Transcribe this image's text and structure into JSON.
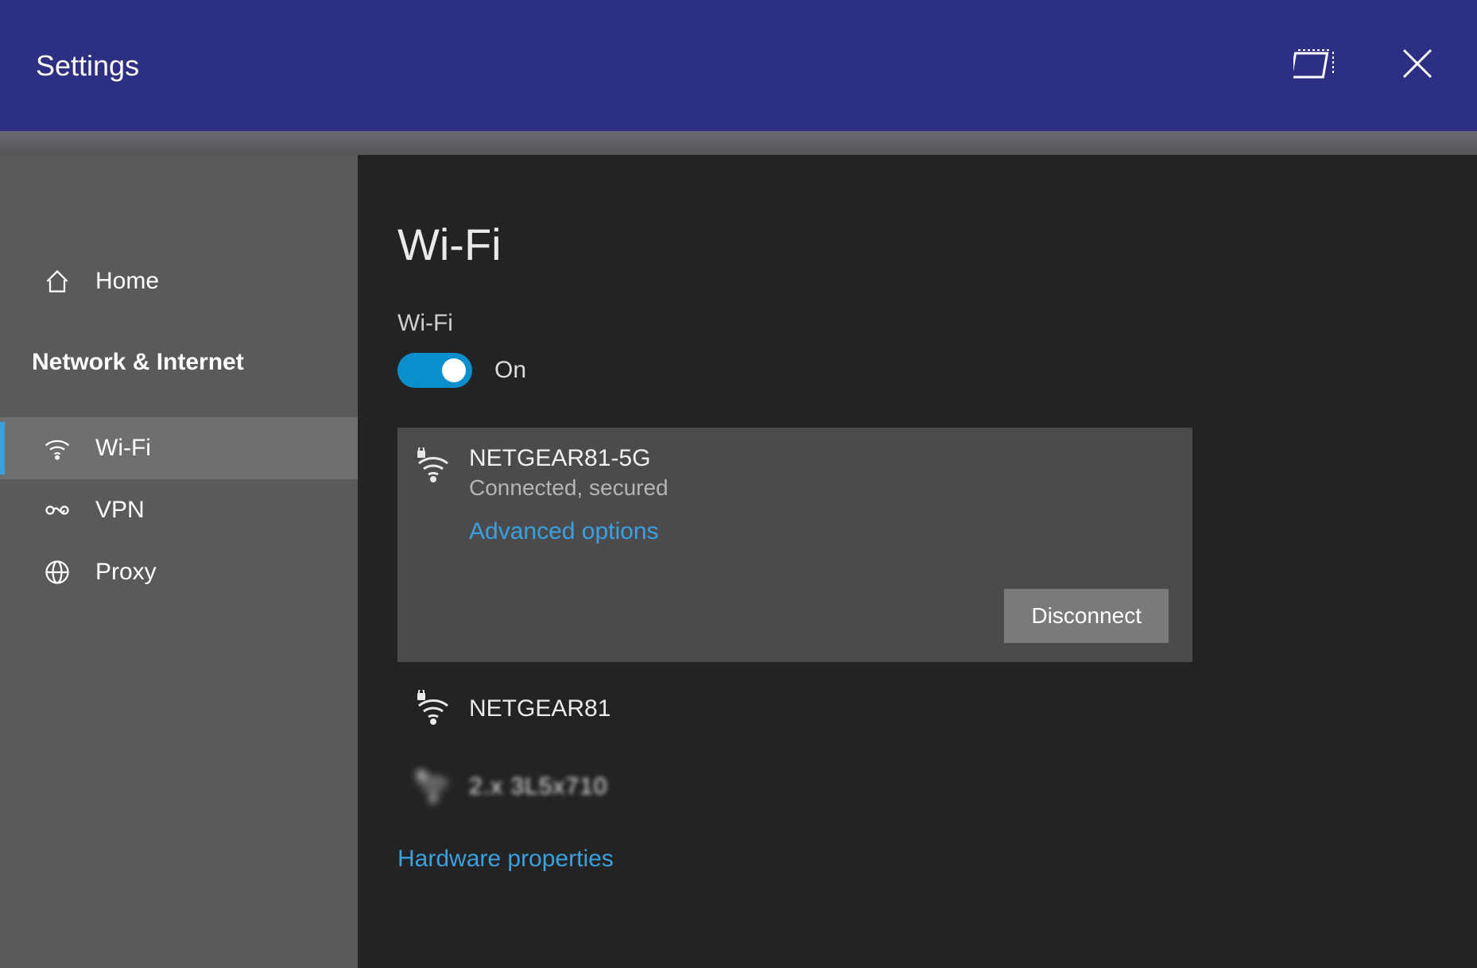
{
  "titlebar": {
    "title": "Settings"
  },
  "sidebar": {
    "home": "Home",
    "section_header": "Network & Internet",
    "items": [
      {
        "label": "Wi-Fi"
      },
      {
        "label": "VPN"
      },
      {
        "label": "Proxy"
      }
    ]
  },
  "main": {
    "page_title": "Wi-Fi",
    "wifi_label": "Wi-Fi",
    "toggle_state": "On",
    "connected_network": {
      "name": "NETGEAR81-5G",
      "status": "Connected, secured",
      "advanced_link": "Advanced options",
      "disconnect_label": "Disconnect"
    },
    "other_networks": [
      {
        "name": "NETGEAR81",
        "secured": true
      },
      {
        "name": "2.x 3L5x710",
        "secured": true,
        "blurred": true
      }
    ],
    "hardware_link": "Hardware properties"
  }
}
